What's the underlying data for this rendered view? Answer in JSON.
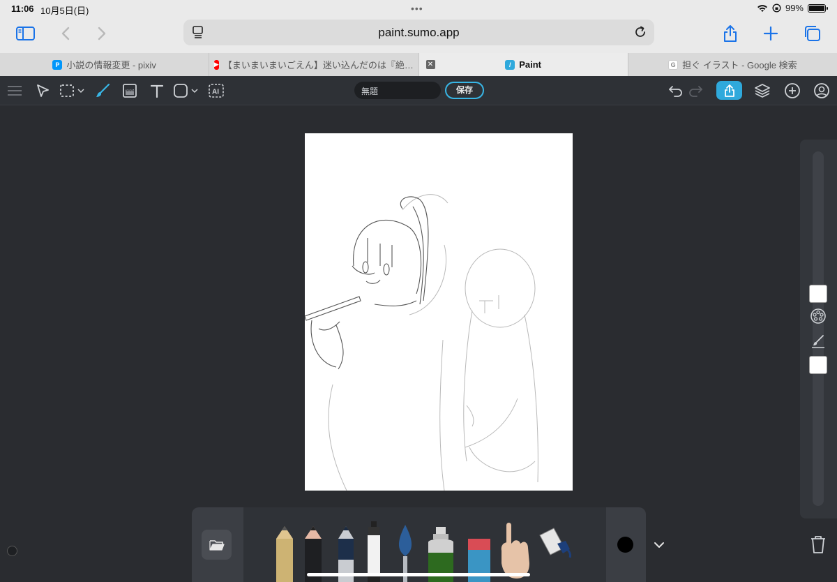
{
  "status": {
    "time": "11:06",
    "date": "10月5日(日)",
    "battery": "99%",
    "battery_level": 0.99
  },
  "browser": {
    "url": "paint.sumo.app",
    "accent": "#1a73e8"
  },
  "tabs": [
    {
      "label": "小説の情報変更 - pixiv",
      "favicon": "pixiv-icon",
      "active": false
    },
    {
      "label": "【まいまいまいごえん】迷い込んだのは『絶…",
      "favicon": "youtube-icon",
      "active": false
    },
    {
      "label": "Paint",
      "favicon": "paint-icon",
      "active": true
    },
    {
      "label": "担ぐ イラスト - Google 検索",
      "favicon": "google-icon",
      "active": false
    }
  ],
  "app": {
    "title_value": "無題",
    "save_label": "保存",
    "accent": "#2fa9dc",
    "current_color": "#000000"
  },
  "brushes": [
    "pencil",
    "dark-pencil",
    "blue-pencil",
    "marker",
    "watercolor",
    "spray",
    "eraser",
    "hand",
    "fill-tool"
  ]
}
